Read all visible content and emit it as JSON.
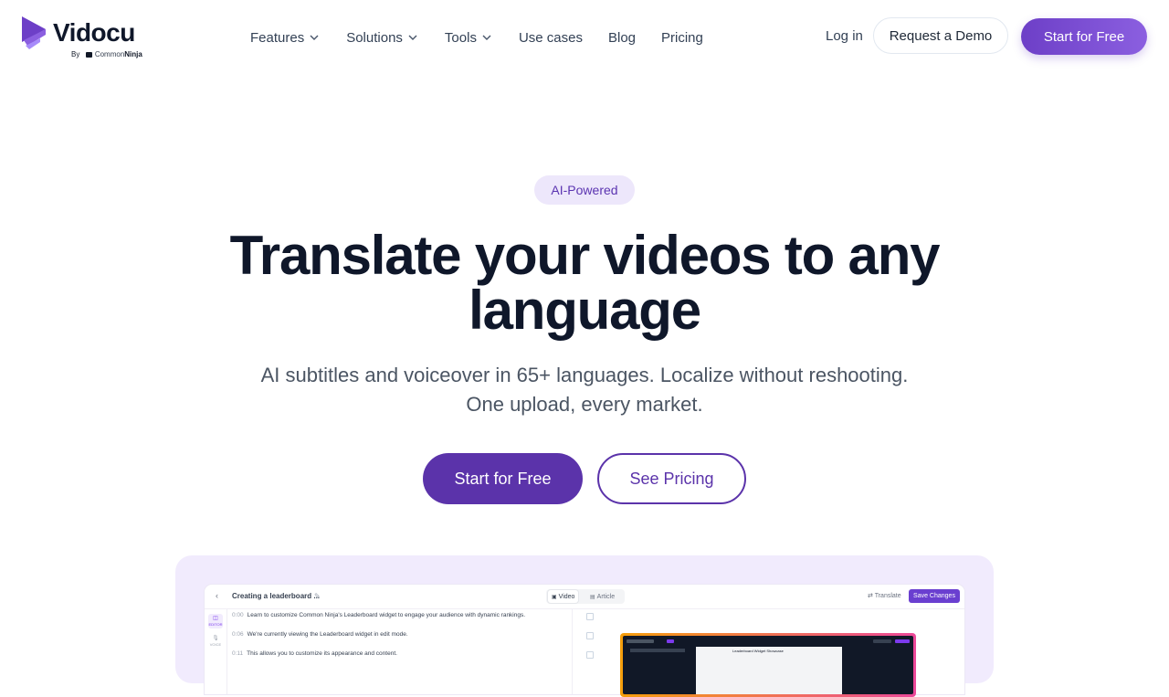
{
  "brand": {
    "name": "Vidocu",
    "byline_prefix": "By",
    "byline_company_a": "Common",
    "byline_company_b": "Ninja",
    "accent": "#5b33aa",
    "accent_light": "#ede7fb",
    "gradient": [
      "#6d3fc7",
      "#8b5fe0"
    ]
  },
  "nav": {
    "items": [
      {
        "label": "Features",
        "dropdown": true
      },
      {
        "label": "Solutions",
        "dropdown": true
      },
      {
        "label": "Tools",
        "dropdown": true
      },
      {
        "label": "Use cases",
        "dropdown": false
      },
      {
        "label": "Blog",
        "dropdown": false
      },
      {
        "label": "Pricing",
        "dropdown": false
      }
    ],
    "login": "Log in",
    "demo": "Request a Demo",
    "start": "Start for Free"
  },
  "hero": {
    "badge": "AI-Powered",
    "headline_line1": "Translate your videos to any",
    "headline_line2": "language",
    "sub_line1": "AI subtitles and voiceover in 65+ languages. Localize without reshooting.",
    "sub_line2": "One upload, every market.",
    "cta_primary": "Start for Free",
    "cta_secondary": "See Pricing"
  },
  "preview": {
    "title": "Creating a leaderboard ...",
    "tabs": [
      "Video",
      "Article"
    ],
    "active_tab": "Video",
    "translate_label": "Translate",
    "save_label": "Save Changes",
    "side": [
      {
        "label": "EDITOR",
        "icon": "layers-icon"
      },
      {
        "label": "VOICE",
        "icon": "microphone-icon"
      }
    ],
    "transcript": [
      {
        "time": "0:00",
        "text": "Learn to customize Common Ninja's Leaderboard widget to engage your audience with dynamic rankings."
      },
      {
        "time": "0:06",
        "text": "We're currently viewing the Leaderboard widget in edit mode."
      },
      {
        "time": "0:11",
        "text": "This allows you to customize its appearance and content."
      }
    ],
    "video_caption": "Leaderboard Widget Showcase"
  }
}
